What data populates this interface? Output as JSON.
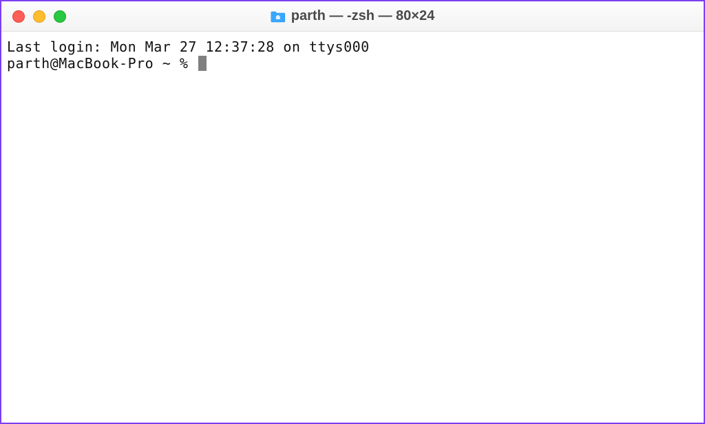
{
  "window": {
    "title": "parth — -zsh — 80×24",
    "traffic_lights": {
      "close": "close",
      "minimize": "minimize",
      "maximize": "maximize"
    },
    "folder_icon": "home-folder-icon"
  },
  "terminal": {
    "last_login_line": "Last login: Mon Mar 27 12:37:28 on ttys000",
    "prompt": "parth@MacBook-Pro ~ % "
  }
}
